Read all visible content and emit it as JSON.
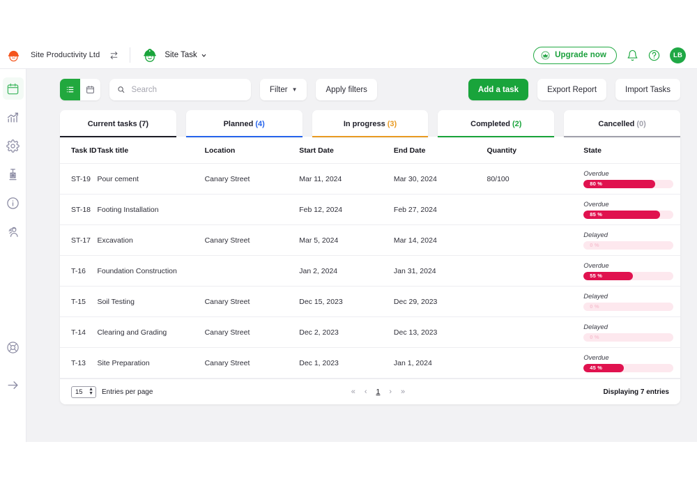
{
  "topbar": {
    "org_logo_icon": "hardhat-worker-logo-orange",
    "org_name": "Site Productivity Ltd",
    "switch_icon": "swap-arrows-icon",
    "project_logo_icon": "hardhat-worker-logo-green",
    "project_name": "Site Task",
    "project_caret_icon": "chevron-down-icon",
    "upgrade_label": "Upgrade now",
    "upgrade_icon": "crown-icon",
    "bell_icon": "bell-icon",
    "help_icon": "question-circle-icon",
    "avatar_initials": "LB",
    "accent_green": "#1aa03c"
  },
  "rail": {
    "items": [
      {
        "name": "calendar",
        "icon": "calendar-icon",
        "active": true
      },
      {
        "name": "analytics",
        "icon": "bar-chart-trend-icon",
        "active": false
      },
      {
        "name": "settings",
        "icon": "gear-icon",
        "active": false
      },
      {
        "name": "crane",
        "icon": "crane-icon",
        "active": false
      },
      {
        "name": "info",
        "icon": "info-circle-icon",
        "active": false
      },
      {
        "name": "workers",
        "icon": "worker-person-icon",
        "active": false
      }
    ],
    "bottom": [
      {
        "name": "support",
        "icon": "life-buoy-icon"
      },
      {
        "name": "expand",
        "icon": "arrow-right-icon"
      }
    ]
  },
  "toolbar": {
    "view_list_icon": "list-view-icon",
    "view_calendar_icon": "calendar-view-icon",
    "search_icon": "search-icon",
    "search_value": "",
    "search_placeholder": "Search",
    "filter_label": "Filter",
    "filter_caret_icon": "caret-down-icon",
    "apply_filters_label": "Apply filters",
    "add_task_label": "Add a task",
    "export_report_label": "Export Report",
    "import_tasks_label": "Import Tasks"
  },
  "tabs": [
    {
      "label": "Current tasks",
      "count": "(7)",
      "count_color": "#20202a",
      "underline": "#1d1d26",
      "active": true
    },
    {
      "label": "Planned",
      "count": "(4)",
      "count_color": "#2563eb",
      "underline": "#2563eb",
      "active": false
    },
    {
      "label": "In progress",
      "count": "(3)",
      "count_color": "#e89a22",
      "underline": "#e89a22",
      "active": false
    },
    {
      "label": "Completed",
      "count": "(2)",
      "count_color": "#19a43b",
      "underline": "#19a43b",
      "active": false
    },
    {
      "label": "Cancelled",
      "count": "(0)",
      "count_color": "#a0a0ab",
      "underline": "#a0a0ab",
      "active": false
    }
  ],
  "table": {
    "columns": [
      "Task ID",
      "Task title",
      "Location",
      "Start Date",
      "End Date",
      "Quantity",
      "State"
    ],
    "rows": [
      {
        "id": "ST-19",
        "title": "Pour cement",
        "location": "Canary Street",
        "start": "Mar 11, 2024",
        "end": "Mar 30, 2024",
        "quantity": "80/100",
        "state": "Overdue",
        "percent": 80,
        "percent_label": "80 %"
      },
      {
        "id": "ST-18",
        "title": "Footing Installation",
        "location": "",
        "start": "Feb 12, 2024",
        "end": "Feb 27, 2024",
        "quantity": "",
        "state": "Overdue",
        "percent": 85,
        "percent_label": "85 %"
      },
      {
        "id": "ST-17",
        "title": "Excavation",
        "location": "Canary Street",
        "start": "Mar 5, 2024",
        "end": "Mar 14, 2024",
        "quantity": "",
        "state": "Delayed",
        "percent": 0,
        "percent_label": "0 %"
      },
      {
        "id": "T-16",
        "title": "Foundation Construction",
        "location": "",
        "start": "Jan 2, 2024",
        "end": "Jan 31, 2024",
        "quantity": "",
        "state": "Overdue",
        "percent": 55,
        "percent_label": "55 %"
      },
      {
        "id": "T-15",
        "title": "Soil Testing",
        "location": "Canary Street",
        "start": "Dec 15, 2023",
        "end": "Dec 29, 2023",
        "quantity": "",
        "state": "Delayed",
        "percent": 0,
        "percent_label": "0 %"
      },
      {
        "id": "T-14",
        "title": "Clearing and Grading",
        "location": "Canary Street",
        "start": "Dec 2, 2023",
        "end": "Dec 13, 2023",
        "quantity": "",
        "state": "Delayed",
        "percent": 0,
        "percent_label": "0 %"
      },
      {
        "id": "T-13",
        "title": "Site Preparation",
        "location": "Canary Street",
        "start": "Dec 1, 2023",
        "end": "Jan 1, 2024",
        "quantity": "",
        "state": "Overdue",
        "percent": 45,
        "percent_label": "45 %"
      }
    ],
    "bar_fill_color": "#e0124f",
    "bar_track_color": "#fde8ee",
    "bar_zero_text_color": "#f7c3d2"
  },
  "footer": {
    "entries_per_page_value": "15",
    "entries_per_page_label": "Entries per page",
    "pager": {
      "first": "«",
      "prev": "‹",
      "current": "1",
      "next": "›",
      "last": "»"
    },
    "displaying": "Displaying 7 entries"
  }
}
